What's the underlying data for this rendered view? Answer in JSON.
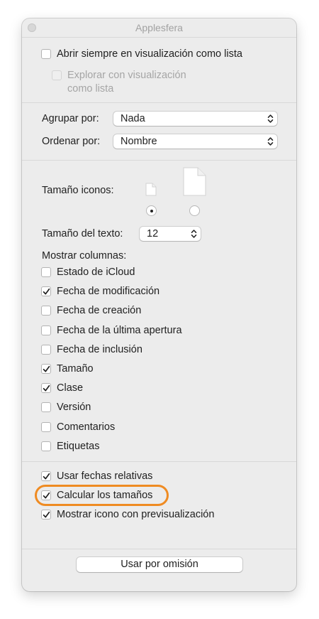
{
  "window": {
    "title": "Applesfera",
    "accent_color": "#ef8b22"
  },
  "list_view": {
    "always_open_label": "Abrir siempre en visualización como lista",
    "always_open_checked": false,
    "browse_line1": "Explorar con visualización",
    "browse_line2": "como lista",
    "browse_checked": false,
    "browse_disabled": true
  },
  "grouping": {
    "group_label": "Agrupar por:",
    "group_value": "Nada",
    "sort_label": "Ordenar por:",
    "sort_value": "Nombre"
  },
  "icon_size": {
    "label": "Tamaño iconos:",
    "small_icon": "small-document-icon",
    "large_icon": "large-document-icon",
    "selected": "small"
  },
  "text_size": {
    "label": "Tamaño del texto:",
    "value": "12"
  },
  "columns": {
    "label": "Mostrar columnas:",
    "items": [
      {
        "label": "Estado de iCloud",
        "checked": false
      },
      {
        "label": "Fecha de modificación",
        "checked": true
      },
      {
        "label": "Fecha de creación",
        "checked": false
      },
      {
        "label": "Fecha de la última apertura",
        "checked": false
      },
      {
        "label": "Fecha de inclusión",
        "checked": false
      },
      {
        "label": "Tamaño",
        "checked": true
      },
      {
        "label": "Clase",
        "checked": true
      },
      {
        "label": "Versión",
        "checked": false
      },
      {
        "label": "Comentarios",
        "checked": false
      },
      {
        "label": "Etiquetas",
        "checked": false
      }
    ]
  },
  "options": {
    "items": [
      {
        "label": "Usar fechas relativas",
        "checked": true
      },
      {
        "label": "Calcular los tamaños",
        "checked": true
      },
      {
        "label": "Mostrar icono con previsualización",
        "checked": true
      }
    ]
  },
  "footer": {
    "default_button": "Usar por omisión"
  }
}
